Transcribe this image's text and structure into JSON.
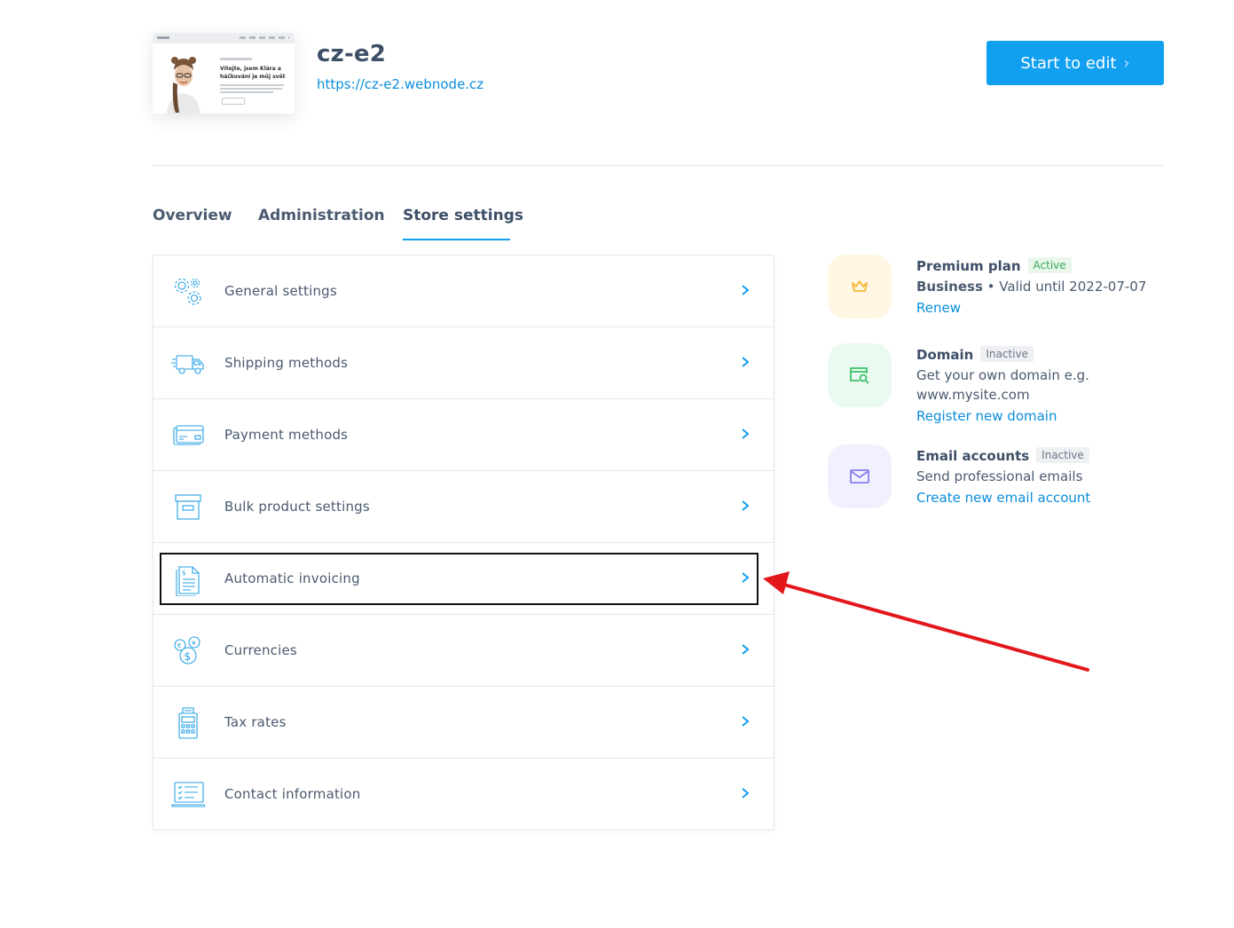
{
  "header": {
    "site_name": "cz-e2",
    "site_url": "https://cz-e2.webnode.cz",
    "start_button": "Start to edit",
    "thumbnail_heading": "Vítejte, jsem Klára a háčkování je můj svět"
  },
  "tabs": [
    {
      "label": "Overview",
      "active": false
    },
    {
      "label": "Administration",
      "active": false
    },
    {
      "label": "Store settings",
      "active": true
    }
  ],
  "settings": [
    {
      "label": "General settings",
      "icon": "gears-icon"
    },
    {
      "label": "Shipping methods",
      "icon": "truck-icon"
    },
    {
      "label": "Payment methods",
      "icon": "card-icon"
    },
    {
      "label": "Bulk product settings",
      "icon": "box-icon"
    },
    {
      "label": "Automatic invoicing",
      "icon": "invoice-icon"
    },
    {
      "label": "Currencies",
      "icon": "currencies-icon"
    },
    {
      "label": "Tax rates",
      "icon": "calculator-icon"
    },
    {
      "label": "Contact information",
      "icon": "laptop-checklist-icon"
    }
  ],
  "features": {
    "premium": {
      "title": "Premium plan",
      "status": "Active",
      "plan": "Business",
      "valid": " • Valid until 2022-07-07",
      "link": "Renew",
      "icon": "crown-icon",
      "color": "#f5b82e"
    },
    "domain": {
      "title": "Domain",
      "status": "Inactive",
      "description": "Get your own domain e.g. www.mysite.com",
      "link": "Register new domain",
      "icon": "domain-search-icon",
      "color": "#3cc06a"
    },
    "email": {
      "title": "Email accounts",
      "status": "Inactive",
      "description": "Send professional emails",
      "link": "Create new email account",
      "icon": "envelope-icon",
      "color": "#8a7ef0"
    }
  },
  "colors": {
    "accent": "#119ff0",
    "link": "#0a8ddb",
    "annotation_arrow": "#e3161b"
  }
}
